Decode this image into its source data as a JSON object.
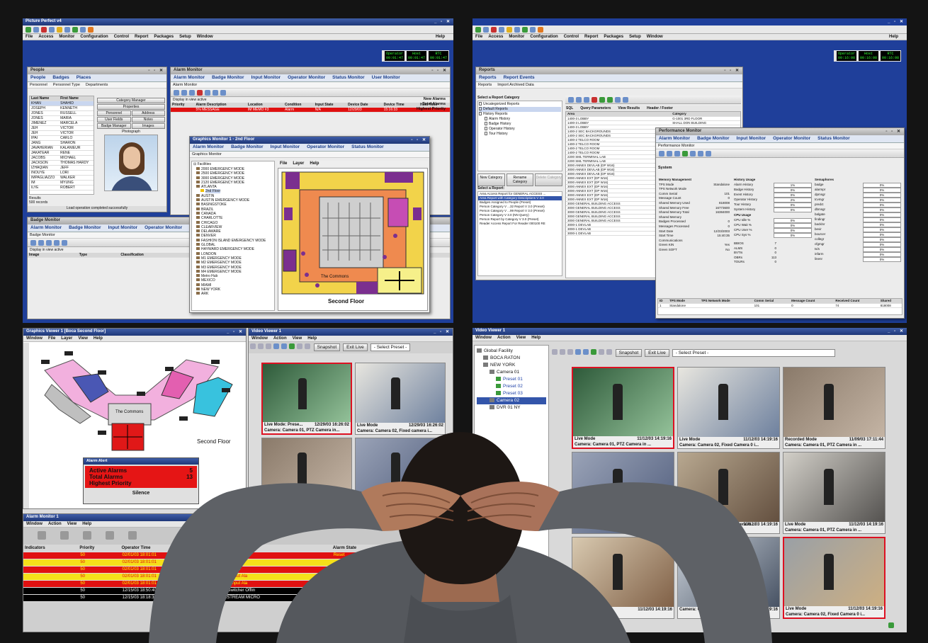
{
  "tl": {
    "app_title": "Picture Perfect v4",
    "menu": [
      "File",
      "Access",
      "Monitor",
      "Configuration",
      "Control",
      "Report",
      "Packages",
      "Setup",
      "Window"
    ],
    "help": "Help",
    "status": [
      {
        "label": "Operator",
        "val": "00:01:47"
      },
      {
        "label": "Host",
        "val": "00:01:47"
      },
      {
        "label": "RTC",
        "val": "00:01:47"
      }
    ],
    "people": {
      "title": "People",
      "tabs": [
        "People",
        "Badges",
        "Places"
      ],
      "subtabs": [
        "Personnel",
        "Personnel Type",
        "Departments"
      ],
      "cols": [
        "Last Name",
        "First Name"
      ],
      "rows": [
        [
          "KHAN",
          "SHAHID"
        ],
        [
          "JOSEPH",
          "KENNETH"
        ],
        [
          "JONES",
          "RUSSELL"
        ],
        [
          "JONES",
          "MARIA"
        ],
        [
          "JIMENEZ",
          "MARCELA"
        ],
        [
          "JEH",
          "VICTOR"
        ],
        [
          "JEH",
          "VICTOR"
        ],
        [
          "IPAI",
          "CARLO"
        ],
        [
          "JANG",
          "SHARON"
        ],
        [
          "JAVAHERIAN",
          "KALANIEUR"
        ],
        [
          "JAKATEAR",
          "RENE"
        ],
        [
          "JACOBS",
          "MICHAEL"
        ],
        [
          "JACKSON",
          "THOMAS HARDY"
        ],
        [
          "IZHAQIAN",
          "JEFF"
        ],
        [
          "INOUYE",
          "LORI"
        ],
        [
          "IMPAGLIAZZO",
          "WALKER"
        ],
        [
          "IM",
          "MYUNG"
        ],
        [
          "ILYE",
          "ROBERT"
        ]
      ],
      "buttons": [
        "Category Manager",
        "Properties",
        "Personnel",
        "Address",
        "User Fields",
        "Notes",
        "Badge Manager",
        "Images"
      ],
      "photo_label": "Photograph",
      "results": "Results",
      "records": "500 records",
      "status": "Load operation completed successfully"
    },
    "alarm": {
      "title": "Alarm Monitor",
      "tabs": [
        "Alarm Monitor",
        "Badge Monitor",
        "Input Monitor",
        "Operator Monitor",
        "Status Monitor",
        "User Monitor"
      ],
      "sub": "Alarm Monitor",
      "new_alarms": "New Alarms",
      "total_alarms": "Total Alarms",
      "highest": "Highest Priority",
      "display": "Display in view active",
      "cols": [
        "Priority",
        "Alarm Description",
        "Location",
        "Condition",
        "Input State",
        "Device Date",
        "Device Time",
        "Host Time"
      ],
      "row": [
        "",
        "5% MESSAGE",
        "IM MEMO #3",
        "Alarm",
        "N/A",
        "12/29/03",
        "15:16:33",
        ""
      ]
    },
    "badge": {
      "title": "Badge Monitor",
      "tabs": [
        "Alarm Monitor",
        "Badge Monitor",
        "Input Monitor",
        "Operator Monitor"
      ],
      "sub": "Badge Monitor",
      "display": "Display in view active",
      "cols": [
        "Image",
        "Type",
        "Classification",
        "Device Date",
        "Device Time",
        "First N"
      ]
    },
    "graphics": {
      "title": "Graphics Monitor 1 - 2nd Floor",
      "tabs": [
        "Alarm Monitor",
        "Badge Monitor",
        "Input Monitor",
        "Operator Monitor",
        "Status Monitor"
      ],
      "sub": "Graphics Monitor",
      "menu": [
        "File",
        "Layer",
        "Help"
      ],
      "tree_root": "Facilities",
      "tree": [
        "2000 EMERGENCY MODE",
        "2500 EMERGENCY MODE",
        "3000 EMERGENCY MODE",
        "2120 EMERGENCY MODE",
        "ATLANTA",
        "2nd Floor",
        "AUSTIN",
        "AUSTIN EMERGENCY MODE",
        "BASINGSTOKE",
        "BRAZIL",
        "CANADA",
        "CHARLOTTE",
        "CHICAGO",
        "CLEARVIEW",
        "DELAWARE",
        "DENVER",
        "FASHION ISLAND EMERGENCY MODE",
        "GLOBAL",
        "HAYWARD EMERGENCY MODE",
        "LONDON",
        "M1 EMERGENCY MODE",
        "M2 EMERGENCY MODE",
        "M3 EMERGENCY MODE",
        "M4 EMERGENCY MODE",
        "Metro Hub",
        "MEXICO",
        "MIAMI",
        "NEW YORK",
        "ARK"
      ],
      "label_commons": "The Commons",
      "label_floor": "Second Floor"
    }
  },
  "tr": {
    "menu": [
      "File",
      "Access",
      "Monitor",
      "Configuration",
      "Control",
      "Report",
      "Packages",
      "Setup",
      "Window"
    ],
    "help": "Help",
    "status": [
      {
        "label": "Operator",
        "val": "00:16:08"
      },
      {
        "label": "Host",
        "val": "00:16:08"
      },
      {
        "label": "RTC",
        "val": "00:16:08"
      }
    ],
    "reports": {
      "title": "Reports",
      "tabs": [
        "Reports",
        "Report Events"
      ],
      "subtabs": [
        "Reports",
        "Import Archived Data"
      ],
      "select_cat": "Select a Report Category",
      "cats": [
        "Uncategorized Reports",
        "Default Reports",
        "History Reports",
        "Alarm History",
        "Badge History",
        "Operator History",
        "Tour History"
      ],
      "btns": [
        "New Category",
        "Rename Category",
        "Delete Category"
      ],
      "select_rep": "Select a Report:",
      "reports": [
        "Area Access Report for GENERAL ACCESS ...",
        "Area Report with Category Descriptions V 3.0",
        "Badges Assigned to People (Preset)",
        "Person Category V ...32 Report V 3.0 (Preset)",
        "Person Category V ...99 Report V 3.0 (Preset)",
        "Person Category V 3.0 (NN Query)",
        "Person Report by Category V 3.0 (Preset)",
        "Reader Access Report For Reader 000100 RE"
      ],
      "qtabs": [
        "SQL",
        "Query Parameters",
        "View Results",
        "Header / Footer"
      ],
      "rcols": [
        "Area",
        "Category"
      ],
      "rrows": [
        [
          "1400-3 LOBBY",
          "G-1001 3RD FLOOR"
        ],
        [
          "1400-3 LOBBY",
          "SHALL DON BUILDING"
        ],
        [
          "1400-3 LOBBY",
          ""
        ],
        [
          "1400-2 SEC BACKGROUNDS",
          ""
        ],
        [
          "1400-2 SEC BACKGROUNDS",
          ""
        ],
        [
          "1400-2 TELCO ROOM",
          ""
        ],
        [
          "1400-2 TELCO ROOM",
          ""
        ],
        [
          "1400-2 TELCO ROOM",
          ""
        ],
        [
          "1400-2 TELCO ROOM",
          ""
        ],
        [
          "2200 SML TERMINAL LAB",
          ""
        ],
        [
          "2200 SML TERMINAL LAB",
          ""
        ],
        [
          "3000 ANNEX DEVLAB (DP W16)",
          ""
        ],
        [
          "3000 ANNEX DEVLAB (DP W16)",
          ""
        ],
        [
          "3000 ANNEX DEVLAB (DP W16)",
          ""
        ],
        [
          "3000 ANNEX EXT (DP W16)",
          ""
        ],
        [
          "3000 ANNEX EXT (DP W16)",
          ""
        ],
        [
          "3000 ANNEX EXT (DP W16)",
          ""
        ],
        [
          "3000 ANNEX EXT (DP W16)",
          ""
        ],
        [
          "3000 ANNEX EXT (DP W16)",
          ""
        ],
        [
          "3000 ANNEX EXT (DP W16)",
          ""
        ],
        [
          "3000 GENERAL BUILDING ACCESS",
          ""
        ],
        [
          "3000 GENERAL BUILDING ACCESS",
          ""
        ],
        [
          "3000 GENERAL BUILDING ACCESS",
          ""
        ],
        [
          "3000 GENERAL BUILDING ACCESS",
          ""
        ],
        [
          "3000 GENERAL BUILDING ACCESS",
          ""
        ],
        [
          "3000-1 DEVLAB",
          ""
        ],
        [
          "3000-1 DEVLAB",
          ""
        ],
        [
          "3000-1 DEVLAB",
          ""
        ]
      ]
    },
    "perf": {
      "title": "Performance Monitor",
      "tabs": [
        "Alarm Monitor",
        "Badge Monitor",
        "Input Monitor",
        "Operator Monitor",
        "Status Monitor"
      ],
      "sub": "Performance Monitor",
      "system": "System",
      "mem_head": "Memory Management",
      "mem": [
        [
          "TPS Mode",
          "Standalone"
        ],
        [
          "TPS Network Mode",
          ""
        ],
        [
          "Comm Serial",
          "101"
        ],
        [
          "Message Count",
          "0"
        ],
        [
          "",
          ""
        ],
        [
          "Shared Memory Used",
          "818008"
        ],
        [
          "Shared Memory Free",
          "16773600"
        ],
        [
          "Shared Memory Total",
          "16384000"
        ],
        [
          "Shared Memory",
          ""
        ],
        [
          "",
          ""
        ],
        [
          "Badges Processed",
          "0"
        ],
        [
          "Messages Processed",
          "0"
        ],
        [
          "",
          ""
        ],
        [
          "Start Date",
          "12/23/2003"
        ],
        [
          "Start Time",
          "15:40:35"
        ],
        [
          "",
          ""
        ],
        [
          "Communications",
          ""
        ],
        [
          "Green KIN",
          "Yes"
        ],
        [
          "Green SOFT",
          "No"
        ]
      ],
      "hist_head": "History Usage",
      "hist": [
        [
          "Alarm History",
          "1%"
        ],
        [
          "Badge History",
          "0%"
        ],
        [
          "Event History",
          "0%"
        ],
        [
          "Operator History",
          "2%"
        ],
        [
          "Tour History",
          "0%"
        ],
        [
          "System History",
          "0%"
        ]
      ],
      "cpu_head": "CPU Usage",
      "cpu": [
        [
          "CPU Idle %",
          "0%"
        ],
        [
          "CPU Wait %",
          "0%"
        ],
        [
          "CPU User %",
          "0%"
        ],
        [
          "CPU Sys %",
          "0%"
        ]
      ],
      "misc": [
        [
          "BBIOS",
          "7"
        ],
        [
          "ALMS",
          "0"
        ],
        [
          "BVTIs",
          "0"
        ],
        [
          "OBRs",
          "113"
        ],
        [
          "TOURs",
          "0"
        ]
      ],
      "sem_head": "Semaphores",
      "sem": [
        [
          "badge",
          "0%"
        ],
        [
          "alarmpr",
          "0%"
        ],
        [
          "dpmsgr",
          "0%"
        ],
        [
          "tcvmgr",
          "0%"
        ],
        [
          "predct",
          "0%"
        ],
        [
          "dbmsgr",
          "0%"
        ],
        [
          "balgate",
          "0%"
        ],
        [
          "findingr",
          "0%"
        ],
        [
          "backlnr",
          "0%"
        ],
        [
          "bevir",
          "0%"
        ],
        [
          "bourcer",
          "0%"
        ],
        [
          "collegr",
          "0%"
        ],
        [
          "cfgmgr",
          "0%"
        ],
        [
          "ts/s",
          "0%"
        ],
        [
          "infarm",
          "0%"
        ],
        [
          "linenr",
          "0%"
        ]
      ],
      "btm_cols": [
        "ID",
        "TPS Mode",
        "TPS Network Mode",
        "Comm Serial",
        "Message Count",
        "Received Count",
        "Shared"
      ],
      "btm_row": [
        "1",
        "Standalone",
        "",
        "101",
        "0",
        "74",
        "818008"
      ]
    }
  },
  "bl": {
    "gv_title": "Graphics Viewer 1 [Boca Second Floor]",
    "gv_menu": [
      "Window",
      "File",
      "Layer",
      "View",
      "Help"
    ],
    "label_commons": "The Commons",
    "label_floor": "Second Floor",
    "alert_title": "Alarm Alert",
    "active_alarms": "Active Alarms",
    "active_val": "5",
    "total_alarms": "Total Alarms",
    "total_val": "13",
    "highest": "Highest Priority",
    "silence": "Silence",
    "vv_title": "Video Viewer 1",
    "vv_menu": [
      "Window",
      "Action",
      "View",
      "Help"
    ],
    "snapshot": "Snapshot",
    "exit_live": "Exit Live",
    "preset": "- Select Preset -",
    "tiles": [
      {
        "mode": "Live Mode: Prese...",
        "ts": "12/29/03 16:26:02",
        "cam": "Camera: Camera 01, PTZ Camera in..."
      },
      {
        "mode": "Live Mode",
        "ts": "12/29/03 16:26:02",
        "cam": "Camera: Camera 02, Fixed camera i..."
      },
      {
        "mode": "",
        "ts": "",
        "cam": ""
      },
      {
        "mode": "Live Mo",
        "ts": "",
        "cam": ""
      }
    ],
    "am_title": "Alarm Monitor 1",
    "am_menu": [
      "Window",
      "Action",
      "View",
      "Help"
    ],
    "am_cols": [
      "Indicators",
      "Priority",
      "Operator Time",
      "Ala",
      "Alarm State",
      "Input State"
    ],
    "am_rows": [
      {
        "pri": "50",
        "time": "02/01/03 18:01:01",
        "desc": "Intrusion Input",
        "state": "Reset",
        "input": "N/A",
        "bg": "#e01010",
        "fg": "#ffff00"
      },
      {
        "pri": "50",
        "time": "02/01/03 18:01:01",
        "desc": "Intrusion Input",
        "state": "",
        "input": "N/A",
        "bg": "#f5e01a",
        "fg": "#e01010"
      },
      {
        "pri": "50",
        "time": "02/01/03 18:01:01",
        "desc": "Intrusion Input",
        "state": "",
        "input": "Active",
        "bg": "#e01010",
        "fg": "#ffff00"
      },
      {
        "pri": "50",
        "time": "02/01/03 18:01:01",
        "desc": "Intrusion Input Ala",
        "state": "Pending",
        "input": "N/A",
        "bg": "#f5e01a",
        "fg": "#e01010"
      },
      {
        "pri": "50",
        "time": "02/01/03 18:01:01",
        "desc": "Intrusion Input Ala",
        "state": "",
        "input": "Active",
        "bg": "#e01010",
        "fg": "#ffff00"
      },
      {
        "pri": "50",
        "time": "12/15/03 18:50:40",
        "desc": "Analog Switcher Offlin",
        "state": "",
        "input": "",
        "bg": "#000000",
        "fg": "#ffffff"
      },
      {
        "pri": "50",
        "time": "12/15/03 18:18:36",
        "desc": "DOWNSTREAM MICRO",
        "state": "",
        "input": "",
        "bg": "#000000",
        "fg": "#ffffff"
      }
    ]
  },
  "br": {
    "title": "Video Viewer 1",
    "menu": [
      "Window",
      "Action",
      "View",
      "Help"
    ],
    "snapshot": "Snapshot",
    "exit_live": "Exit Live",
    "preset": "- Select Preset -",
    "tree": [
      "Global Facility",
      "BOCA RATON",
      "NEW YORK",
      "Camera 01",
      "Preset 01",
      "Preset 02",
      "Preset 03",
      "Camera 02",
      "DVR 01 NY"
    ],
    "tiles": [
      {
        "mode": "Live Mode",
        "ts": "11/12/03 14:19:16",
        "cam": "Camera: Camera 01, PTZ Camera in ..."
      },
      {
        "mode": "Live Mode",
        "ts": "11/12/03 14:19:16",
        "cam": "Camera: Camera 02, Fixed Camera 0 i..."
      },
      {
        "mode": "Recorded Mode",
        "ts": "11/09/03 17:11:44",
        "cam": "Camera: Camera 01, PTZ Camera in ..."
      },
      {
        "mode": "",
        "ts": "",
        "cam": ""
      },
      {
        "mode": "",
        "ts": "11/12/03 14:19:16",
        "cam": "Camera: Camera 01, PTZ Camera in ..."
      },
      {
        "mode": "Live Mode",
        "ts": "11/12/03 14:19:16",
        "cam": "Camera: Camera 01, PTZ Camera in ..."
      },
      {
        "mode": "Live Mo",
        "ts": "11/12/03 14:19:16",
        "cam": "Camera: Ca"
      },
      {
        "mode": "",
        "ts": "11/12/03 14:19:16",
        "cam": "Camera: Camera 01, PTZ Camera in ..."
      },
      {
        "mode": "Live Mode",
        "ts": "11/12/03 14:19:16",
        "cam": "Camera: Camera 02, Fixed Camera 0 i..."
      }
    ]
  },
  "colors": {
    "desktop": "#1f3f9a",
    "alarm_red": "#e01010",
    "alarm_yellow": "#f5e01a",
    "tab_blue": "#1b3e8a",
    "skin": "#b07a5c",
    "shirt": "#5a5d62",
    "hair": "#1d1714"
  }
}
